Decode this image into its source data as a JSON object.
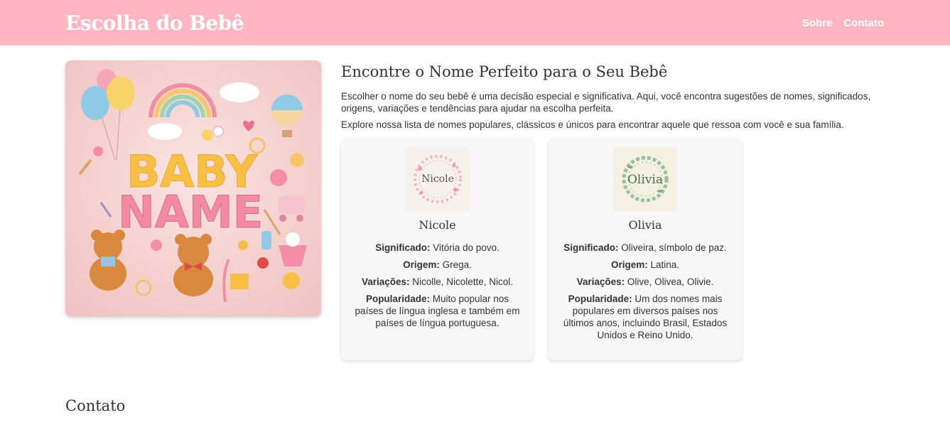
{
  "header": {
    "brand": "Escolha do Bebê",
    "nav": [
      "Sobre",
      "Contato"
    ],
    "bg_color": "#ffb6c1"
  },
  "hero": {
    "image_text_line1": "BABY",
    "image_text_line2": "NAME",
    "icon": "baby-name-illustration"
  },
  "intro": {
    "title": "Encontre o Nome Perfeito para o Seu Bebê",
    "p1": "Escolher o nome do seu bebê é uma decisão especial e significativa. Aqui, você encontra sugestões de nomes, significados, origens, variações e tendências para ajudar na escolha perfeita.",
    "p2": "Explore nossa lista de nomes populares, clássicos e únicos para encontrar aquele que ressoa com você e sua família."
  },
  "labels": {
    "meaning": "Significado:",
    "origin": "Origem:",
    "variations": "Variações:",
    "popularity": "Popularidade:"
  },
  "names": [
    {
      "thumb_text": "Nicole",
      "name": "Nicole",
      "meaning": "Vitória do povo.",
      "origin": "Grega.",
      "variations": "Nicolle, Nicolette, Nicol.",
      "popularity": "Muito popular nos países de língua inglesa e também em países de língua portuguesa."
    },
    {
      "thumb_text": "Olivia",
      "name": "Olivia",
      "meaning": "Oliveira, símbolo de paz.",
      "origin": "Latina.",
      "variations": "Olive, Olivea, Olivie.",
      "popularity": "Um dos nomes mais populares em diversos países nos últimos anos, incluindo Brasil, Estados Unidos e Reino Unido."
    }
  ],
  "contact": {
    "title": "Contato"
  }
}
